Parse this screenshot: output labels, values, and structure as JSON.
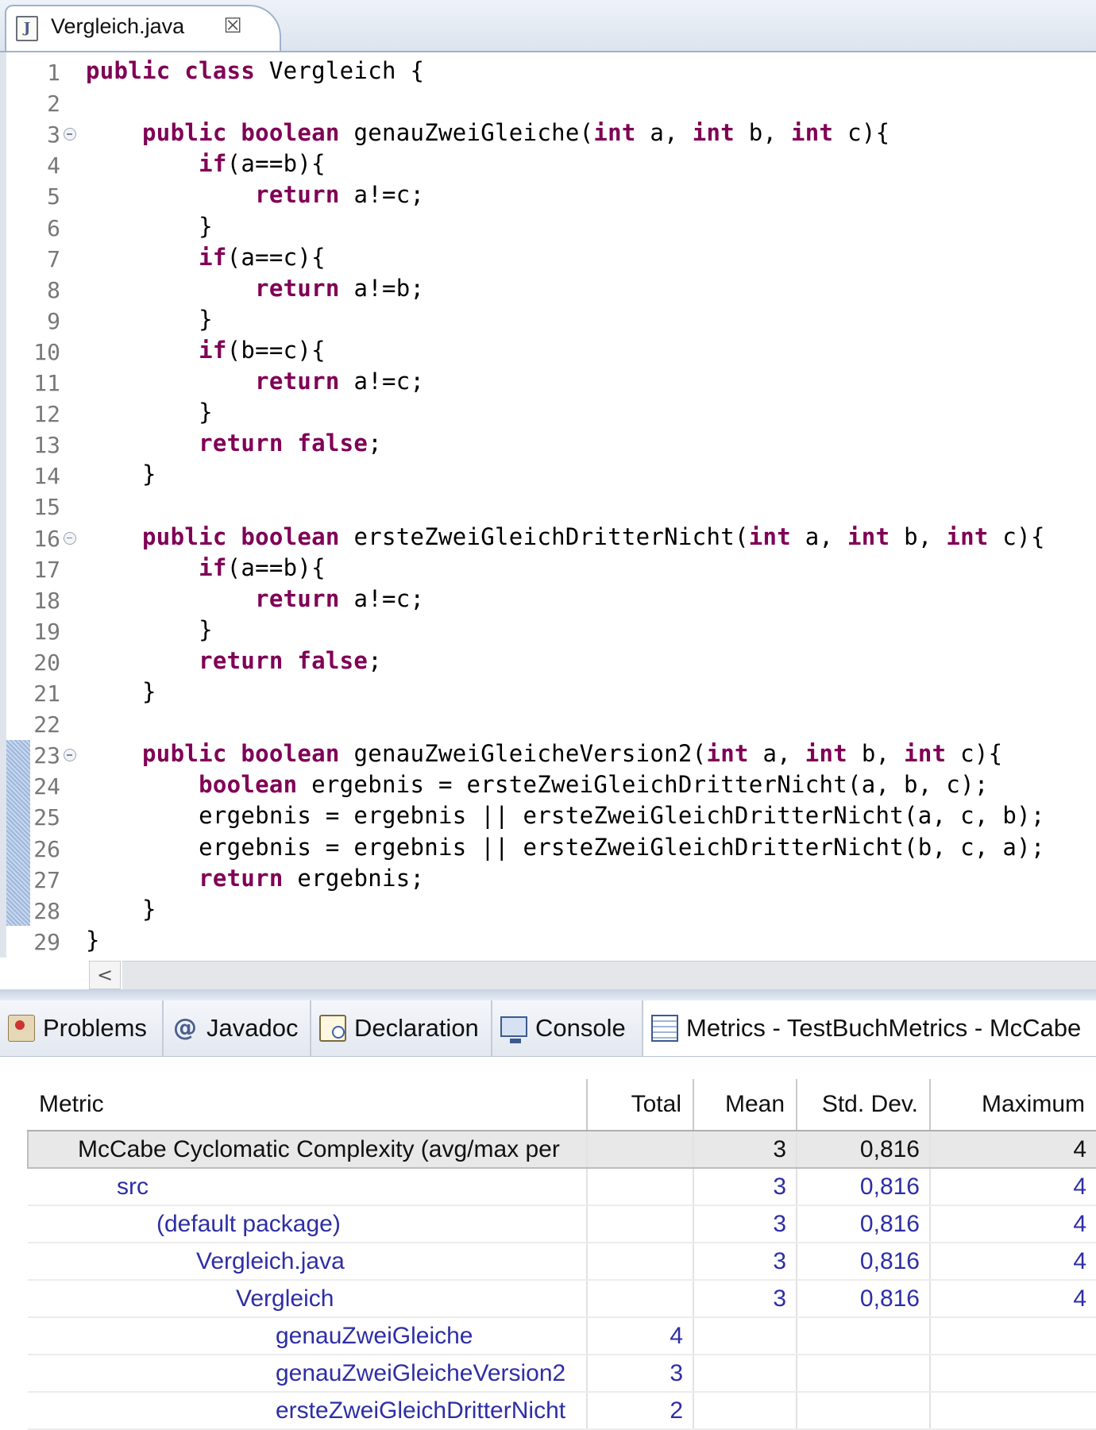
{
  "editor_tab": {
    "title": "Vergleich.java",
    "icon_letter": "J",
    "close_glyph": "☒"
  },
  "code_lines": [
    {
      "n": "1",
      "fold": false,
      "segs": [
        [
          "kw",
          "public class "
        ],
        [
          "",
          "Vergleich {"
        ]
      ]
    },
    {
      "n": "2",
      "fold": false,
      "segs": []
    },
    {
      "n": "3",
      "fold": true,
      "segs": [
        [
          "",
          "    "
        ],
        [
          "kw",
          "public boolean "
        ],
        [
          "",
          "genauZweiGleiche("
        ],
        [
          "kw",
          "int "
        ],
        [
          "",
          "a, "
        ],
        [
          "kw",
          "int "
        ],
        [
          "",
          "b, "
        ],
        [
          "kw",
          "int "
        ],
        [
          "",
          "c){"
        ]
      ]
    },
    {
      "n": "4",
      "fold": false,
      "segs": [
        [
          "",
          "        "
        ],
        [
          "kw",
          "if"
        ],
        [
          "",
          "(a==b){"
        ]
      ]
    },
    {
      "n": "5",
      "fold": false,
      "segs": [
        [
          "",
          "            "
        ],
        [
          "kw",
          "return "
        ],
        [
          "",
          "a!=c;"
        ]
      ]
    },
    {
      "n": "6",
      "fold": false,
      "segs": [
        [
          "",
          "        }"
        ]
      ]
    },
    {
      "n": "7",
      "fold": false,
      "segs": [
        [
          "",
          "        "
        ],
        [
          "kw",
          "if"
        ],
        [
          "",
          "(a==c){"
        ]
      ]
    },
    {
      "n": "8",
      "fold": false,
      "segs": [
        [
          "",
          "            "
        ],
        [
          "kw",
          "return "
        ],
        [
          "",
          "a!=b;"
        ]
      ]
    },
    {
      "n": "9",
      "fold": false,
      "segs": [
        [
          "",
          "        }"
        ]
      ]
    },
    {
      "n": "10",
      "fold": false,
      "segs": [
        [
          "",
          "        "
        ],
        [
          "kw",
          "if"
        ],
        [
          "",
          "(b==c){"
        ]
      ]
    },
    {
      "n": "11",
      "fold": false,
      "segs": [
        [
          "",
          "            "
        ],
        [
          "kw",
          "return "
        ],
        [
          "",
          "a!=c;"
        ]
      ]
    },
    {
      "n": "12",
      "fold": false,
      "segs": [
        [
          "",
          "        }"
        ]
      ]
    },
    {
      "n": "13",
      "fold": false,
      "segs": [
        [
          "",
          "        "
        ],
        [
          "kw",
          "return false"
        ],
        [
          "",
          ";"
        ]
      ]
    },
    {
      "n": "14",
      "fold": false,
      "segs": [
        [
          "",
          "    }"
        ]
      ]
    },
    {
      "n": "15",
      "fold": false,
      "segs": []
    },
    {
      "n": "16",
      "fold": true,
      "segs": [
        [
          "",
          "    "
        ],
        [
          "kw",
          "public boolean "
        ],
        [
          "",
          "ersteZweiGleichDritterNicht("
        ],
        [
          "kw",
          "int "
        ],
        [
          "",
          "a, "
        ],
        [
          "kw",
          "int "
        ],
        [
          "",
          "b, "
        ],
        [
          "kw",
          "int "
        ],
        [
          "",
          "c){"
        ]
      ]
    },
    {
      "n": "17",
      "fold": false,
      "segs": [
        [
          "",
          "        "
        ],
        [
          "kw",
          "if"
        ],
        [
          "",
          "(a==b){"
        ]
      ]
    },
    {
      "n": "18",
      "fold": false,
      "segs": [
        [
          "",
          "            "
        ],
        [
          "kw",
          "return "
        ],
        [
          "",
          "a!=c;"
        ]
      ]
    },
    {
      "n": "19",
      "fold": false,
      "segs": [
        [
          "",
          "        }"
        ]
      ]
    },
    {
      "n": "20",
      "fold": false,
      "segs": [
        [
          "",
          "        "
        ],
        [
          "kw",
          "return false"
        ],
        [
          "",
          ";"
        ]
      ]
    },
    {
      "n": "21",
      "fold": false,
      "segs": [
        [
          "",
          "    }"
        ]
      ]
    },
    {
      "n": "22",
      "fold": false,
      "segs": []
    },
    {
      "n": "23",
      "fold": true,
      "segs": [
        [
          "",
          "    "
        ],
        [
          "kw",
          "public boolean "
        ],
        [
          "",
          "genauZweiGleicheVersion2("
        ],
        [
          "kw",
          "int "
        ],
        [
          "",
          "a, "
        ],
        [
          "kw",
          "int "
        ],
        [
          "",
          "b, "
        ],
        [
          "kw",
          "int "
        ],
        [
          "",
          "c){"
        ]
      ]
    },
    {
      "n": "24",
      "fold": false,
      "segs": [
        [
          "",
          "        "
        ],
        [
          "kw",
          "boolean "
        ],
        [
          "",
          "ergebnis = ersteZweiGleichDritterNicht(a, b, c);"
        ]
      ]
    },
    {
      "n": "25",
      "fold": false,
      "segs": [
        [
          "",
          "        ergebnis = ergebnis || ersteZweiGleichDritterNicht(a, c, b);"
        ]
      ]
    },
    {
      "n": "26",
      "fold": false,
      "segs": [
        [
          "",
          "        ergebnis = ergebnis || ersteZweiGleichDritterNicht(b, c, a);"
        ]
      ]
    },
    {
      "n": "27",
      "fold": false,
      "segs": [
        [
          "",
          "        "
        ],
        [
          "kw",
          "return "
        ],
        [
          "",
          "ergebnis;"
        ]
      ]
    },
    {
      "n": "28",
      "fold": false,
      "segs": [
        [
          "",
          "    }"
        ]
      ]
    },
    {
      "n": "29",
      "fold": false,
      "segs": [
        [
          "",
          "}"
        ]
      ]
    }
  ],
  "scroll_left_glyph": "<",
  "view_tabs": [
    {
      "label": "Problems",
      "icon": "problems-icon"
    },
    {
      "label": "Javadoc",
      "icon": "javadoc-icon",
      "glyph": "@"
    },
    {
      "label": "Declaration",
      "icon": "declaration-icon"
    },
    {
      "label": "Console",
      "icon": "console-icon"
    },
    {
      "label": "Metrics - TestBuchMetrics - McCabe",
      "icon": "metrics-icon"
    }
  ],
  "metrics": {
    "columns": [
      "Metric",
      "Total",
      "Mean",
      "Std. Dev.",
      "Maximum"
    ],
    "rows": [
      {
        "name": "McCabe Cyclomatic Complexity (avg/max per",
        "total": "",
        "mean": "3",
        "std": "0,816",
        "max": "4"
      },
      {
        "name": "src",
        "total": "",
        "mean": "3",
        "std": "0,816",
        "max": "4"
      },
      {
        "name": "(default package)",
        "total": "",
        "mean": "3",
        "std": "0,816",
        "max": "4"
      },
      {
        "name": "Vergleich.java",
        "total": "",
        "mean": "3",
        "std": "0,816",
        "max": "4"
      },
      {
        "name": "Vergleich",
        "total": "",
        "mean": "3",
        "std": "0,816",
        "max": "4"
      },
      {
        "name": "genauZweiGleiche",
        "total": "4",
        "mean": "",
        "std": "",
        "max": ""
      },
      {
        "name": "genauZweiGleicheVersion2",
        "total": "3",
        "mean": "",
        "std": "",
        "max": ""
      },
      {
        "name": "ersteZweiGleichDritterNicht",
        "total": "2",
        "mean": "",
        "std": "",
        "max": ""
      }
    ]
  },
  "colors": {
    "keyword": "#7f0055",
    "metric_link": "#2e2ea6",
    "selected_row": "#e8e8e8"
  }
}
